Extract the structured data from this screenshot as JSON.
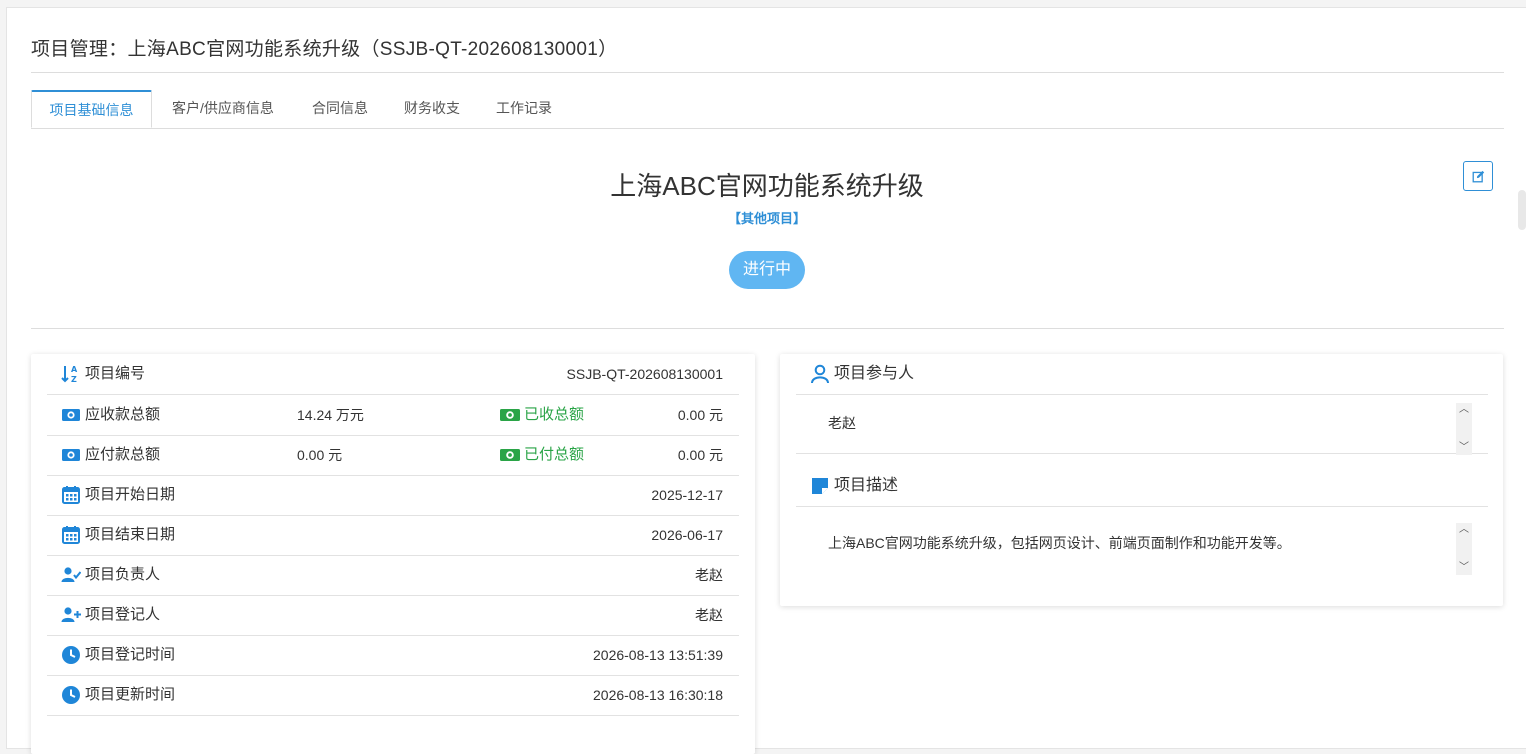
{
  "page": {
    "title": "项目管理：上海ABC官网功能系统升级（SSJB-QT-202608130001）"
  },
  "tabs": [
    {
      "label": "项目基础信息",
      "active": true
    },
    {
      "label": "客户/供应商信息",
      "active": false
    },
    {
      "label": "合同信息",
      "active": false
    },
    {
      "label": "财务收支",
      "active": false
    },
    {
      "label": "工作记录",
      "active": false
    }
  ],
  "project": {
    "name": "上海ABC官网功能系统升级",
    "type": "【其他项目】",
    "status": "进行中"
  },
  "info": {
    "code": {
      "label": "项目编号",
      "value": "SSJB-QT-202608130001"
    },
    "receivable": {
      "label": "应收款总额",
      "value": "14.24 万元",
      "paid_label": "已收总额",
      "paid_value": "0.00 元"
    },
    "payable": {
      "label": "应付款总额",
      "value": "0.00 元",
      "paid_label": "已付总额",
      "paid_value": "0.00 元"
    },
    "start_date": {
      "label": "项目开始日期",
      "value": "2025-12-17"
    },
    "end_date": {
      "label": "项目结束日期",
      "value": "2026-06-17"
    },
    "owner": {
      "label": "项目负责人",
      "value": "老赵"
    },
    "registrar": {
      "label": "项目登记人",
      "value": "老赵"
    },
    "registered_at": {
      "label": "项目登记时间",
      "value": "2026-08-13 13:51:39"
    },
    "updated_at": {
      "label": "项目更新时间",
      "value": "2026-08-13 16:30:18"
    }
  },
  "participants": {
    "label": "项目参与人",
    "value": "老赵"
  },
  "description": {
    "label": "项目描述",
    "value": "上海ABC官网功能系统升级，包括网页设计、前端页面制作和功能开发等。"
  },
  "colors": {
    "accent": "#2f8fd6",
    "status_pill": "#60b6f2",
    "green": "#2aa447"
  },
  "icons": {
    "edit": "edit-icon",
    "code": "sort-alpha-icon",
    "money": "money-icon",
    "calendar": "calendar-icon",
    "user_check": "user-check-icon",
    "user_plus": "user-plus-icon",
    "clock": "clock-icon",
    "user": "user-icon",
    "note": "sticky-note-icon"
  }
}
